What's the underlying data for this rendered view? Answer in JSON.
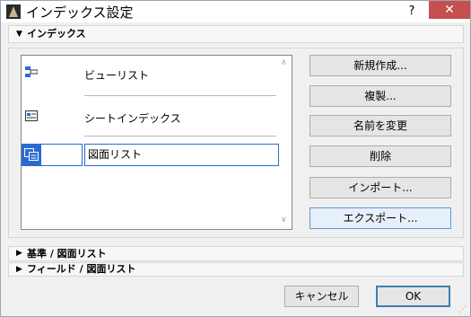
{
  "window": {
    "title": "インデックス設定",
    "help_label": "?",
    "close_label": "✕"
  },
  "sections": {
    "index": {
      "label": "インデックス",
      "expanded": true
    },
    "criteria": {
      "label": "基準 /  図面リスト",
      "expanded": false
    },
    "fields": {
      "label": "フィールド /  図面リスト",
      "expanded": false
    }
  },
  "list": {
    "items": [
      {
        "label": "ビューリスト",
        "icon": "view-list-icon"
      },
      {
        "label": "シートインデックス",
        "icon": "sheet-index-icon"
      },
      {
        "label": "図面リスト",
        "icon": "drawing-list-icon",
        "selected": true
      }
    ]
  },
  "actions": {
    "new": "新規作成...",
    "duplicate": "複製...",
    "rename": "名前を変更",
    "delete": "削除",
    "import": "インポート...",
    "export": "エクスポート..."
  },
  "footer": {
    "cancel": "キャンセル",
    "ok": "OK"
  },
  "colors": {
    "accent": "#2a6bd3",
    "close": "#c74f4f"
  }
}
